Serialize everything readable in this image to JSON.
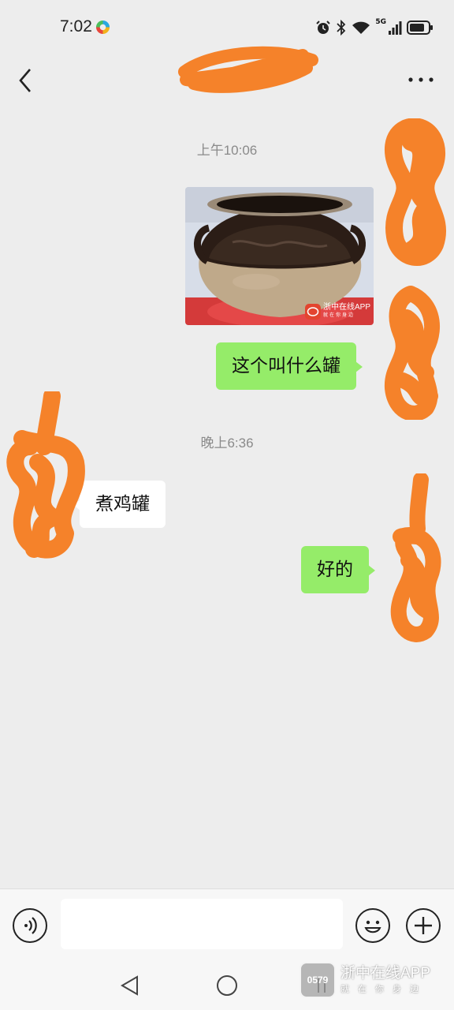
{
  "status_bar": {
    "time": "7:02",
    "network": "5G",
    "icons": [
      "alarm-icon",
      "bluetooth-icon",
      "wifi-icon",
      "signal-icon",
      "battery-icon"
    ]
  },
  "header": {
    "back_icon": "chevron-left-icon",
    "title": "",
    "more_icon": "more-dots-icon"
  },
  "messages": [
    {
      "type": "timestamp",
      "text": "上午10:06"
    },
    {
      "type": "image",
      "direction": "sent",
      "watermark": {
        "name": "浙中在线APP",
        "slogan": "就在你身边"
      }
    },
    {
      "type": "text",
      "direction": "sent",
      "text": "这个叫什么罐"
    },
    {
      "type": "timestamp",
      "text": "晚上6:36"
    },
    {
      "type": "text",
      "direction": "received",
      "text": "煮鸡罐"
    },
    {
      "type": "text",
      "direction": "sent",
      "text": "好的"
    }
  ],
  "input_bar": {
    "voice_icon": "voice-icon",
    "placeholder": "",
    "emoji_icon": "emoji-icon",
    "plus_icon": "plus-icon"
  },
  "system_nav": [
    "back-triangle-icon",
    "home-circle-icon",
    "recents-icon"
  ],
  "watermark": {
    "logo_text": "0579",
    "name": "浙中在线APP",
    "slogan": "就在你身边"
  },
  "colors": {
    "background": "#ededed",
    "sent_bubble": "#95ec69",
    "received_bubble": "#ffffff",
    "redaction": "#f5822a"
  }
}
